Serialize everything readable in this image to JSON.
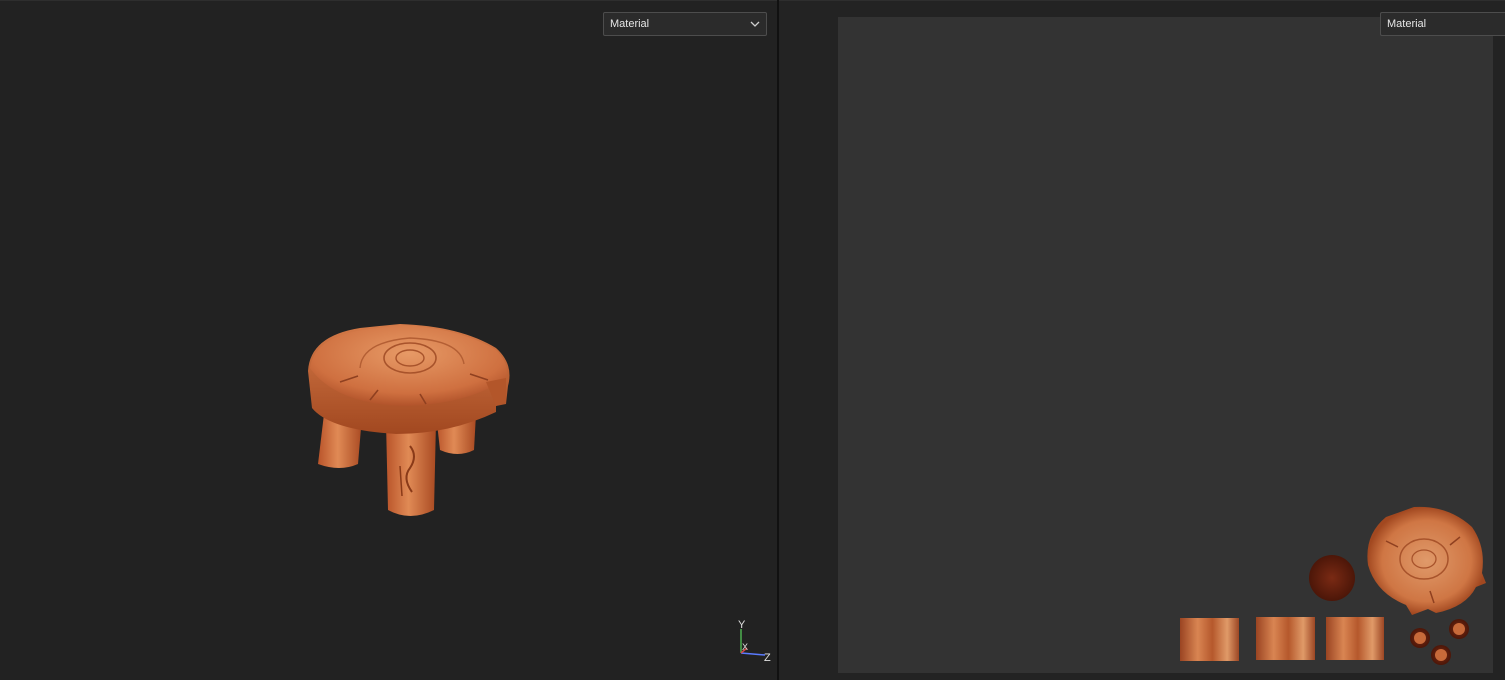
{
  "viewport_3d": {
    "mode_dropdown": {
      "value": "Material"
    },
    "axis_gizmo": {
      "y_label": "Y",
      "x_label": "X",
      "z_label": "Z",
      "icon": "axis-gizmo-icon"
    },
    "model": {
      "icon": "wooden-stool-model"
    }
  },
  "viewport_2d": {
    "mode_dropdown": {
      "value": "Material"
    },
    "texture_icon": "uv-texture-atlas"
  },
  "colors": {
    "background": "#222222",
    "uv_canvas": "#333333",
    "wood": "#c9693a",
    "axis_y": "#4caf50",
    "axis_z": "#5a7bff",
    "axis_x": "#d44444"
  }
}
